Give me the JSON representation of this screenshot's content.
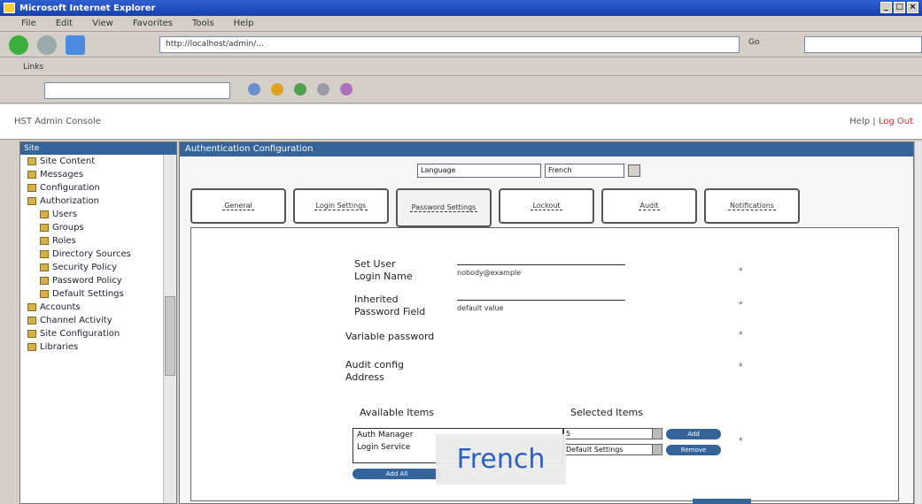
{
  "window": {
    "title": "Microsoft Internet Explorer"
  },
  "menubar": [
    "File",
    "Edit",
    "View",
    "Favorites",
    "Tools",
    "Help"
  ],
  "address": {
    "value": "http://localhost/admin/...",
    "go_label": "Go"
  },
  "links_bar": {
    "text": "Links"
  },
  "app": {
    "breadcrumb": "HST Admin Console",
    "right_text": "Help",
    "right_link": "Log Out"
  },
  "sidebar": {
    "header": "Site",
    "items": [
      {
        "label": "Site Content",
        "sub": false
      },
      {
        "label": "Messages",
        "sub": false
      },
      {
        "label": "Configuration",
        "sub": false
      },
      {
        "label": "Authorization",
        "sub": false
      },
      {
        "label": "Users",
        "sub": true
      },
      {
        "label": "Groups",
        "sub": true
      },
      {
        "label": "Roles",
        "sub": true
      },
      {
        "label": "Directory Sources",
        "sub": true
      },
      {
        "label": "Security Policy",
        "sub": true
      },
      {
        "label": "Password Policy",
        "sub": true
      },
      {
        "label": "Default Settings",
        "sub": true
      },
      {
        "label": "Accounts",
        "sub": false
      },
      {
        "label": "Channel Activity",
        "sub": false
      },
      {
        "label": "Site Configuration",
        "sub": false
      },
      {
        "label": "Libraries",
        "sub": false
      }
    ]
  },
  "main": {
    "header": "Authentication Configuration",
    "language_field": "Language",
    "language_select": "French",
    "tabs": [
      "General",
      "Login Settings",
      "Password Settings",
      "Lockout",
      "Audit",
      "Notifications"
    ],
    "form": {
      "row1_label_a": "Set User",
      "row1_label_b": "Login Name",
      "row1_value": "nobody@example",
      "row2_label_a": "Inherited",
      "row2_label_b": "Password Field",
      "row2_value": "default value",
      "row3_label": "Variable password",
      "row4_label_a": "Audit config",
      "row4_label_b": "Address",
      "avail_header": "Available Items",
      "select_header": "Selected Items",
      "list_items": [
        "Auth Manager",
        "Login Service"
      ],
      "sel_option_1": "5",
      "sel_option_2": "Default Settings",
      "add_label": "Add",
      "remove_label": "Remove",
      "add_all_label": "Add All",
      "marker": "*"
    }
  },
  "overlay": {
    "text": "French"
  }
}
